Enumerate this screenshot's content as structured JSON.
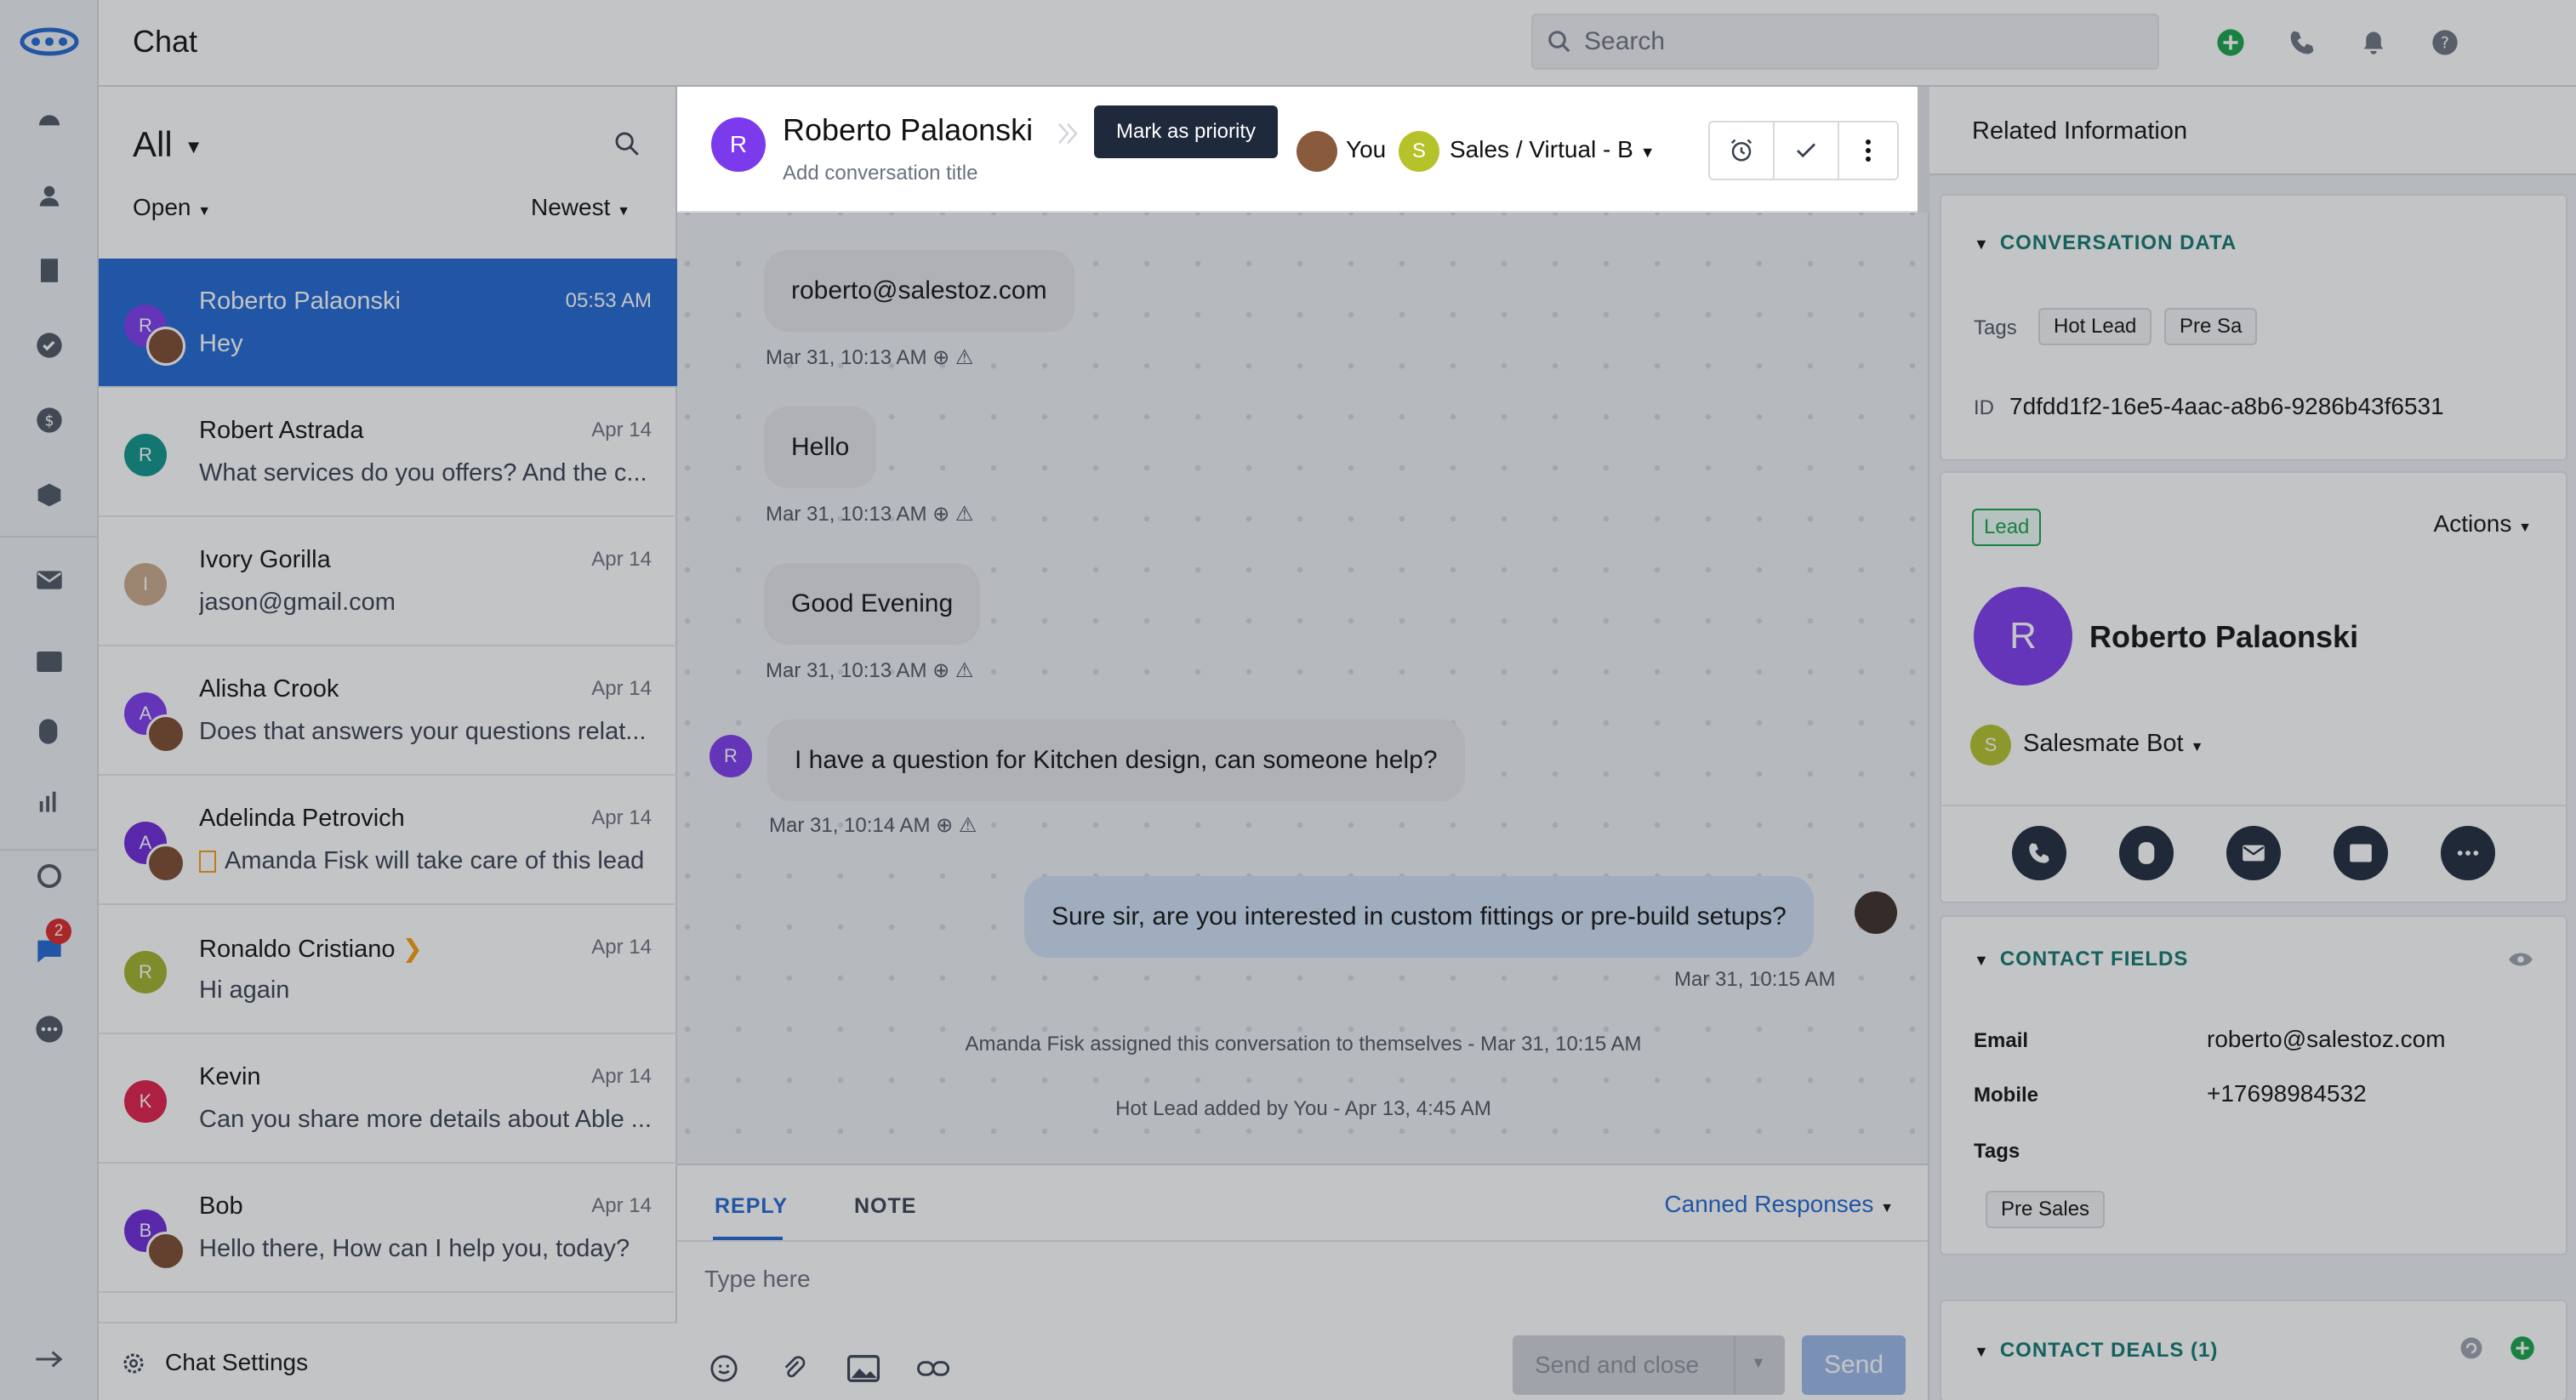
{
  "app": {
    "title": "Chat"
  },
  "topbar": {
    "search_placeholder": "Search",
    "icons": [
      "add-icon",
      "phone-icon",
      "bell-icon",
      "help-icon"
    ],
    "accent": "#16a34a"
  },
  "sidebar": {
    "icons": [
      "dashboard-icon",
      "contacts-icon",
      "companies-icon",
      "tasks-icon",
      "deals-icon",
      "products-icon",
      "email-icon",
      "inbox-icon",
      "calls-icon",
      "reports-icon",
      "automation-icon",
      "chat-icon",
      "more-icon",
      "collapse-icon"
    ],
    "chat_badge": "2"
  },
  "list": {
    "filter_all": "All",
    "filter_status": "Open",
    "sort": "Newest",
    "settings_label": "Chat Settings",
    "items": [
      {
        "initial": "R",
        "name": "Roberto Palaonski",
        "time": "05:53 AM",
        "preview": "Hey",
        "color": "#7c3aed",
        "selected": true
      },
      {
        "initial": "R",
        "name": "Robert Astrada",
        "time": "Apr 14",
        "preview": "What services do you offers? And the c...",
        "color": "#0d9488"
      },
      {
        "initial": "I",
        "name": "Ivory Gorilla",
        "time": "Apr 14",
        "preview": "jason@gmail.com",
        "color": "#c9a98a"
      },
      {
        "initial": "A",
        "name": "Alisha Crook",
        "time": "Apr 14",
        "preview": "Does that answers your questions relat...",
        "color": "#7c3aed"
      },
      {
        "initial": "A",
        "name": "Adelinda Petrovich",
        "time": "Apr 14",
        "preview": "Amanda Fisk will take care of this lead",
        "color": "#6d28d9"
      },
      {
        "initial": "R",
        "name": "Ronaldo Cristiano",
        "time": "Apr 14",
        "preview": "Hi again",
        "color": "#a3b12a"
      },
      {
        "initial": "K",
        "name": "Kevin",
        "time": "Apr 14",
        "preview": "Can you share more details about Able ...",
        "color": "#e11d48"
      },
      {
        "initial": "B",
        "name": "Bob",
        "time": "Apr 14",
        "preview": "Hello there, How can I help you, today?",
        "color": "#6d28d9"
      }
    ]
  },
  "conversation": {
    "initial": "R",
    "name": "Roberto Palaonski",
    "title_placeholder": "Add conversation title",
    "tooltip": "Mark as priority",
    "assignee": "You",
    "team_initial": "S",
    "team": "Sales / Virtual - B",
    "messages": [
      {
        "text": "roberto@salestoz.com",
        "meta": "Mar 31, 10:13 AM"
      },
      {
        "text": "Hello",
        "meta": "Mar 31, 10:13 AM"
      },
      {
        "text": "Good Evening",
        "meta": "Mar 31, 10:13 AM"
      },
      {
        "text": "I have a question for Kitchen design, can someone help?",
        "meta": "Mar 31, 10:14 AM",
        "initial": "R"
      },
      {
        "text": "Sure sir, are you interested in custom fittings or pre-build setups?",
        "meta": "Mar 31, 10:15 AM"
      }
    ],
    "system": [
      "Amanda Fisk assigned this conversation to themselves - Mar 31, 10:15 AM",
      "Hot Lead added by You - Apr 13, 4:45 AM"
    ]
  },
  "composer": {
    "tab_reply": "REPLY",
    "tab_note": "NOTE",
    "canned": "Canned Responses",
    "placeholder": "Type here",
    "send_close": "Send and close",
    "send": "Send"
  },
  "related": {
    "title": "Related Information",
    "conversation_data": {
      "heading": "CONVERSATION DATA",
      "tags_label": "Tags",
      "tags": [
        "Hot Lead",
        "Pre Sa"
      ],
      "id_label": "ID",
      "id": "7dfdd1f2-16e5-4aac-a8b6-9286b43f6531"
    },
    "contact": {
      "badge": "Lead",
      "actions": "Actions",
      "initial": "R",
      "name": "Roberto Palaonski",
      "owner_initial": "S",
      "owner": "Salesmate Bot"
    },
    "contact_fields": {
      "heading": "CONTACT FIELDS",
      "email_label": "Email",
      "email": "roberto@salestoz.com",
      "mobile_label": "Mobile",
      "mobile": "+17698984532",
      "tags_label": "Tags",
      "tag": "Pre Sales"
    },
    "contact_deals": {
      "heading": "CONTACT DEALS (1)"
    }
  }
}
